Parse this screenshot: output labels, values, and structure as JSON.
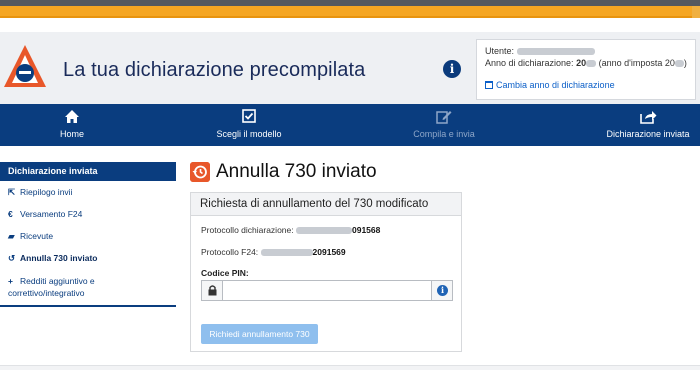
{
  "header": {
    "app_title": "La tua dichiarazione precompilata",
    "user": {
      "label": "Utente:",
      "year_label": "Anno di dichiarazione:",
      "year_value": "20",
      "tax_year_prefix": "(anno d'imposta 20",
      "tax_year_suffix": ")",
      "change_year_link": "Cambia anno di dichiarazione"
    }
  },
  "nav": {
    "items": [
      {
        "label": "Home",
        "icon": "home-icon"
      },
      {
        "label": "Scegli il modello",
        "icon": "checkbox-icon"
      },
      {
        "label": "Compila e invia",
        "icon": "edit-icon"
      },
      {
        "label": "Dichiarazione inviata",
        "icon": "share-icon"
      }
    ]
  },
  "sidebar": {
    "heading": "Dichiarazione inviata",
    "items": [
      {
        "label": "Riepilogo invii",
        "icon": "external-link-icon"
      },
      {
        "label": "Versamento F24",
        "icon": "euro-icon"
      },
      {
        "label": "Ricevute",
        "icon": "folder-icon"
      },
      {
        "label": "Annulla 730 inviato",
        "icon": "history-icon"
      },
      {
        "label": "Redditi aggiuntivo e correttivo/integrativo",
        "icon": "plus-icon"
      }
    ]
  },
  "main": {
    "title": "Annulla 730 inviato",
    "card_title": "Richiesta di annullamento del 730 modificato",
    "protocollo_dichiarazione_label": "Protocollo dichiarazione:",
    "protocollo_dichiarazione_value": "091568",
    "protocollo_f24_label": "Protocollo F24:",
    "protocollo_f24_value": "2091569",
    "pin_label": "Codice PIN:",
    "pin_value": "",
    "submit_label": "Richiedi annullamento 730"
  },
  "colors": {
    "brand_blue": "#0a3d7f",
    "accent_orange": "#f5a623",
    "button_disabled": "#8fbfee",
    "title_icon": "#e8572a"
  }
}
